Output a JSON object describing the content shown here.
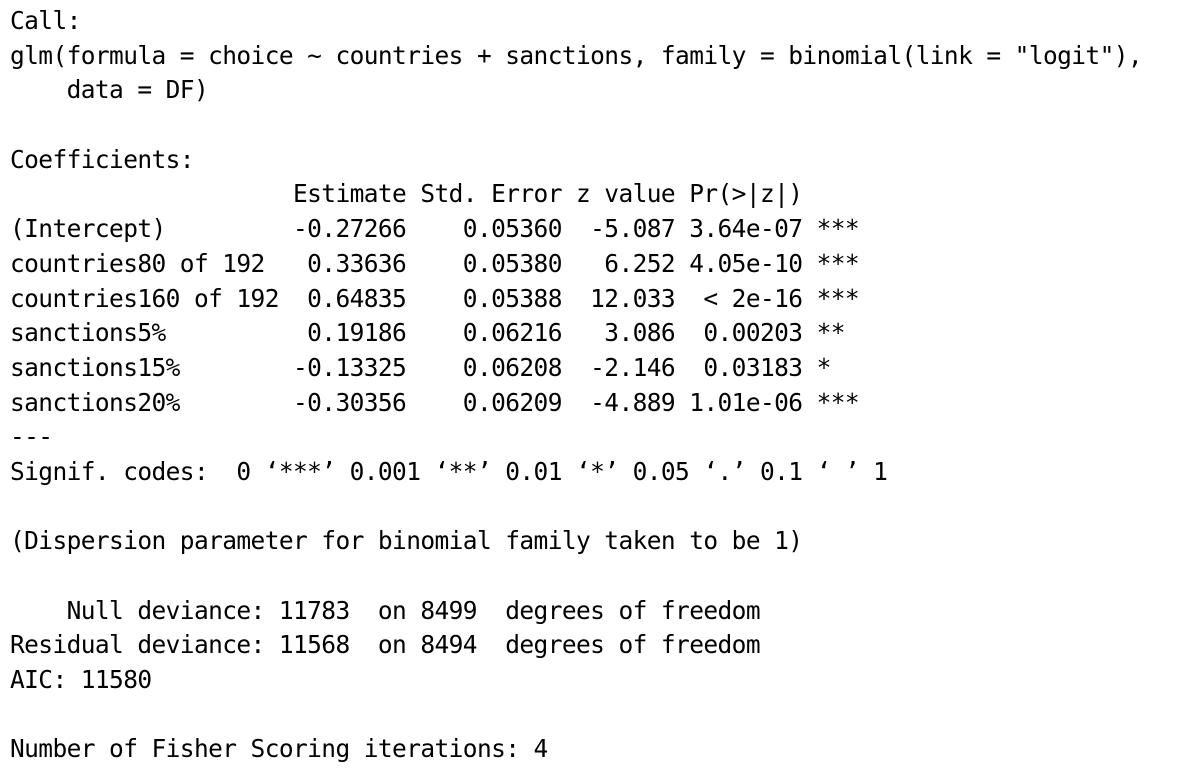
{
  "console": {
    "lines": [
      "Call:",
      "glm(formula = choice ~ countries + sanctions, family = binomial(link = \"logit\"),",
      "    data = DF)",
      "",
      "Coefficients:",
      "                    Estimate Std. Error z value Pr(>|z|)    ",
      "(Intercept)         -0.27266    0.05360  -5.087 3.64e-07 ***",
      "countries80 of 192   0.33636    0.05380   6.252 4.05e-10 ***",
      "countries160 of 192  0.64835    0.05388  12.033  < 2e-16 ***",
      "sanctions5%          0.19186    0.06216   3.086  0.00203 ** ",
      "sanctions15%        -0.13325    0.06208  -2.146  0.03183 *  ",
      "sanctions20%        -0.30356    0.06209  -4.889 1.01e-06 ***",
      "---",
      "Signif. codes:  0 ‘***’ 0.001 ‘**’ 0.01 ‘*’ 0.05 ‘.’ 0.1 ‘ ’ 1",
      "",
      "(Dispersion parameter for binomial family taken to be 1)",
      "",
      "    Null deviance: 11783  on 8499  degrees of freedom",
      "Residual deviance: 11568  on 8494  degrees of freedom",
      "AIC: 11580",
      "",
      "Number of Fisher Scoring iterations: 4"
    ]
  }
}
